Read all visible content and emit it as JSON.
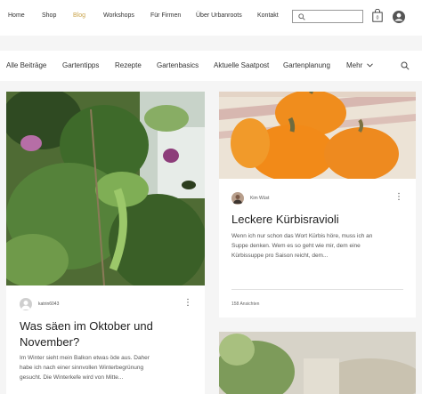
{
  "nav": {
    "items": [
      "Home",
      "Shop",
      "Blog",
      "Workshops",
      "Für Firmen",
      "Über Urbanroots",
      "Kontakt"
    ],
    "active_color": "#c9a34a"
  },
  "search": {
    "placeholder": ""
  },
  "categories": {
    "items": [
      "Alle Beiträge",
      "Gartentipps",
      "Rezepte",
      "Gartenbasics",
      "Aktuelle Saatpost",
      "Gartenplanung",
      "Mehr"
    ]
  },
  "posts": [
    {
      "author": "katrin6043",
      "title_line1": "Was säen im Oktober und",
      "title_line2": "November?",
      "excerpt_line1": "Im Winter sieht mein Balkon etwas öde aus. Daher",
      "excerpt_line2": "habe ich nach einer sinnvollen Winterbegrünung",
      "excerpt_line3": "gesucht. Die Winterkefe wird von Mitte..."
    },
    {
      "author": "Kim Wüst",
      "title": "Leckere Kürbisravioli",
      "excerpt_line1": "Wenn ich nur schon das Wort Kürbis höre, muss ich an",
      "excerpt_line2": "Suppe denken. Wem es so geht wie mir, dem eine",
      "excerpt_line3": "Kürbissuppe pro Saison reicht, dem...",
      "views": "158 Ansichten"
    }
  ],
  "icons": {
    "search": "search-icon",
    "cart": "cart-icon",
    "account": "account-icon",
    "more": "more-dots-icon",
    "chevron": "chevron-down-icon"
  }
}
